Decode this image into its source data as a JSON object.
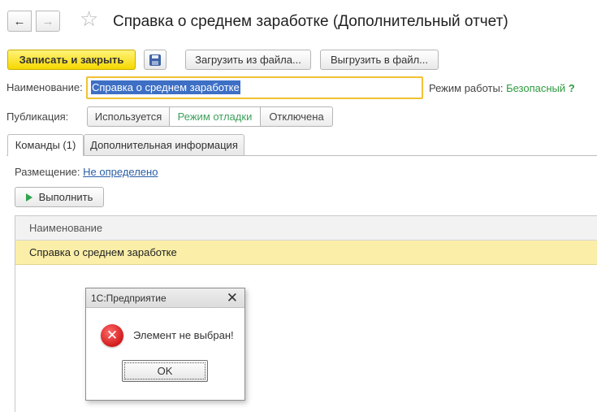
{
  "header": {
    "title": "Справка о среднем заработке (Дополнительный отчет)",
    "back_icon": "←",
    "forward_icon": "→",
    "star_icon": "☆"
  },
  "toolbar": {
    "save_close_label": "Записать и закрыть",
    "load_label": "Загрузить из файла...",
    "unload_label": "Выгрузить в файл..."
  },
  "form": {
    "name_label": "Наименование:",
    "name_value": "Справка о среднем заработке",
    "mode_label": "Режим работы:",
    "mode_value": "Безопасный",
    "help_label": "?",
    "publication_label": "Публикация:",
    "publication_options": [
      "Используется",
      "Режим отладки",
      "Отключена"
    ],
    "publication_selected": "Режим отладки"
  },
  "tabs": [
    {
      "label": "Команды (1)",
      "active": true
    },
    {
      "label": "Дополнительная информация",
      "active": false
    }
  ],
  "commands": {
    "placement_label": "Размещение:",
    "placement_value": "Не определено",
    "execute_label": "Выполнить",
    "table_header": "Наименование",
    "rows": [
      "Справка о среднем заработке"
    ]
  },
  "dialog": {
    "title": "1С:Предприятие",
    "close_icon": "✕",
    "message": "Элемент не выбран!",
    "ok_label": "OK",
    "error_icon": "✕"
  },
  "colors": {
    "accent_yellow": "#f6d800",
    "selected_row": "#fbeea8",
    "green": "#2e9a3e",
    "link": "#2a5ea8",
    "error_red": "#d11b1b"
  }
}
